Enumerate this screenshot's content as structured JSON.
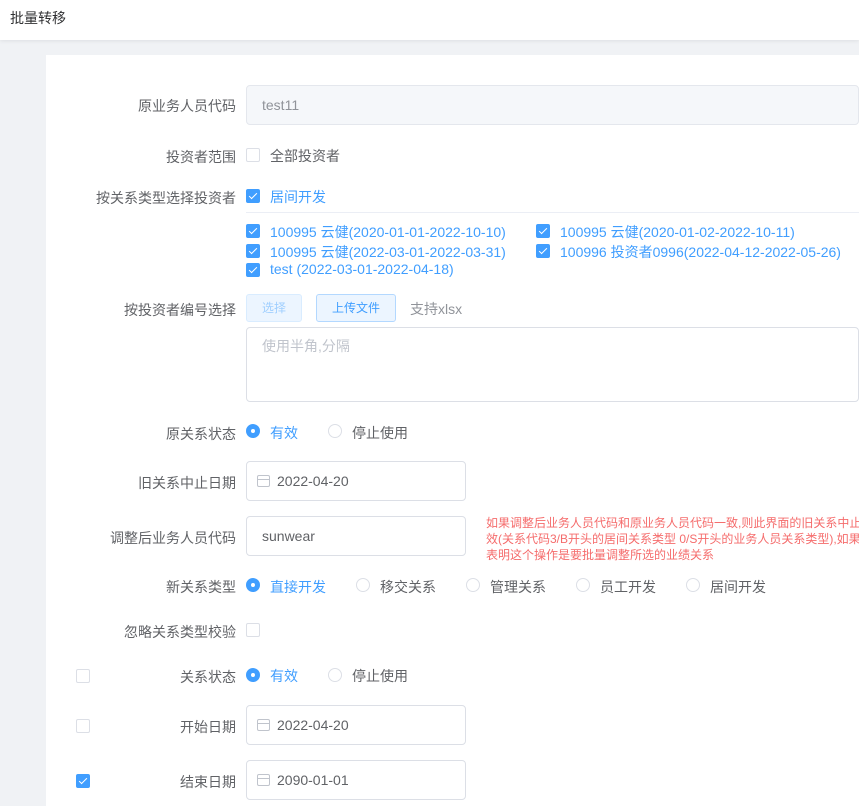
{
  "header": {
    "title": "批量转移"
  },
  "form": {
    "orig_staff": {
      "label": "原业务人员代码",
      "value": "test11"
    },
    "investor_scope": {
      "label": "投资者范围",
      "checkbox_label": "全部投资者"
    },
    "by_relation_type": {
      "label": "按关系类型选择投资者",
      "checkbox_label": "居间开发"
    },
    "relations": [
      "100995 云健(2020-01-01-2022-10-10)",
      "100995 云健(2020-01-02-2022-10-11)",
      "100995 云健(2022-03-01-2022-03-31)",
      "100996 投资者0996(2022-04-12-2022-05-26)",
      "test (2022-03-01-2022-04-18)"
    ],
    "by_investor_no": {
      "label": "按投资者编号选择",
      "select_btn": "选择",
      "upload_btn": "上传文件",
      "support_text": "支持xlsx",
      "placeholder": "使用半角,分隔"
    },
    "orig_status": {
      "label": "原关系状态",
      "options": [
        "有效",
        "停止使用"
      ],
      "selected": "有效"
    },
    "old_end_date": {
      "label": "旧关系中止日期",
      "value": "2022-04-20"
    },
    "new_staff": {
      "label": "调整后业务人员代码",
      "value": "sunwear",
      "hint": [
        "如果调整后业务人员代码和原业务人员代码一致,则此界面的旧关系中止",
        "效(关系代码3/B开头的居间关系类型 0/S开头的业务人员关系类型),如果",
        "表明这个操作是要批量调整所选的业绩关系"
      ]
    },
    "new_type": {
      "label": "新关系类型",
      "options": [
        "直接开发",
        "移交关系",
        "管理关系",
        "员工开发",
        "居间开发"
      ],
      "selected": "直接开发"
    },
    "ignore_check": {
      "label": "忽略关系类型校验"
    },
    "rel_status": {
      "label": "关系状态",
      "options": [
        "有效",
        "停止使用"
      ],
      "selected": "有效"
    },
    "start_date": {
      "label": "开始日期",
      "value": "2022-04-20"
    },
    "end_date": {
      "label": "结束日期",
      "value": "2090-01-01"
    }
  },
  "colors": {
    "primary": "#409eff",
    "danger": "#f56c6c"
  },
  "icons": [
    "checkbox-icon",
    "radio-icon",
    "calendar-icon"
  ]
}
